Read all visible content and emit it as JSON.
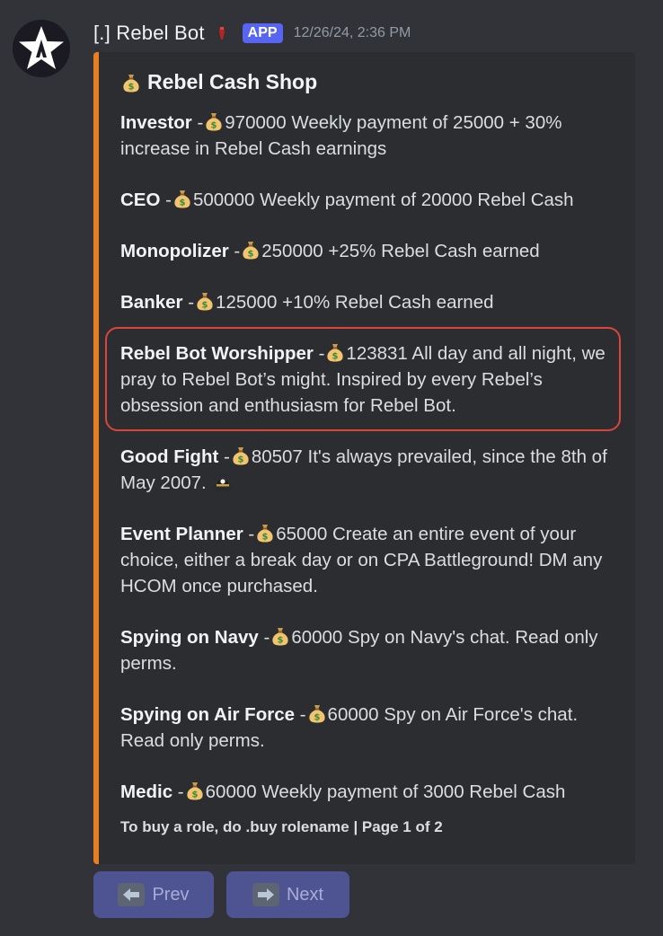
{
  "message": {
    "author": "[.] Rebel Bot",
    "badge": "APP",
    "timestamp": "12/26/24, 2:36 PM",
    "avatar_icon": "star-logo-icon",
    "role_icon": "red-marker-icon"
  },
  "embed": {
    "accent_color": "#e67e22",
    "title": "Rebel Cash Shop",
    "title_icon": "money-bag-icon",
    "items": [
      {
        "name": "Investor",
        "sep": " -",
        "price": "970000",
        "desc": " Weekly payment of 25000 + 30% increase in Rebel Cash earnings"
      },
      {
        "name": "CEO",
        "sep": " -",
        "price": "500000",
        "desc": " Weekly payment of 20000 Rebel Cash"
      },
      {
        "name": "Monopolizer",
        "sep": " -",
        "price": "250000",
        "desc": " +25% Rebel Cash earned"
      },
      {
        "name": "Banker",
        "sep": " -",
        "price": "125000",
        "desc": " +10% Rebel Cash earned"
      },
      {
        "name": "Rebel Bot Worshipper",
        "sep": " -",
        "price": "123831",
        "desc": " All day and all night, we pray to Rebel Bot’s might. Inspired by every Rebel’s obsession and enthusiasm for Rebel Bot."
      },
      {
        "name": "Good Fight",
        "sep": " -",
        "price": "80507",
        "desc": " It's always prevailed, since the 8th of May 2007. "
      },
      {
        "name": "Event Planner",
        "sep": " -",
        "price": "65000",
        "desc": " Create an entire event of your choice, either a break day or on CPA Battleground! DM any HCOM once purchased."
      },
      {
        "name": "Spying on Navy",
        "sep": " -",
        "price": "60000",
        "desc": " Spy on Navy's chat. Read only perms."
      },
      {
        "name": "Spying on Air Force",
        "sep": " -",
        "price": "60000",
        "desc": " Spy on Air Force's chat. Read only perms."
      },
      {
        "name": "Medic",
        "sep": " -",
        "price": "60000",
        "desc": " Weekly payment of 3000 Rebel Cash"
      }
    ],
    "footer": "To buy a role, do .buy rolename | Page 1 of 2"
  },
  "buttons": {
    "prev_label": "Prev",
    "next_label": "Next",
    "color": "#4e5391"
  }
}
